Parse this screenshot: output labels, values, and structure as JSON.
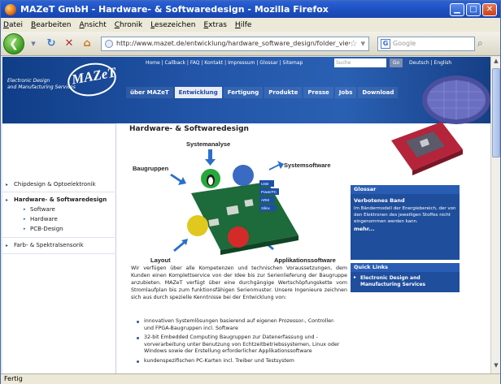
{
  "window": {
    "title": "MAZeT GmbH - Hardware- & Softwaredesign - Mozilla Firefox"
  },
  "menu": [
    "Datei",
    "Bearbeiten",
    "Ansicht",
    "Chronik",
    "Lesezeichen",
    "Extras",
    "Hilfe"
  ],
  "nav": {
    "url": "http://www.mazet.de/entwicklung/hardware_software_design/folder_view",
    "search_placeholder": "Google"
  },
  "site": {
    "logo_word": "MAZeT",
    "logo_tagline_1": "Electronic Design",
    "logo_tagline_2": "and Manufacturing Services",
    "toplinks": "Home | Callback | FAQ | Kontakt | Impressum | Glossar | Sitemap",
    "search_placeholder": "Suche",
    "search_go": "Go",
    "lang": "Deutsch | English",
    "mainnav": [
      "über MAZeT",
      "Entwicklung",
      "Fertigung",
      "Produkte",
      "Presse",
      "Jobs",
      "Download"
    ]
  },
  "leftnav": {
    "items": [
      "Chipdesign & Optoelektronik",
      "Hardware- & Softwaredesign",
      "Farb- & Spektralsensorik"
    ],
    "subitems": [
      "Software",
      "Hardware",
      "PCB-Design"
    ]
  },
  "main": {
    "heading": "Hardware- & Softwaredesign",
    "diagram": {
      "systemanalyse": "Systemanalyse",
      "systemsoftware": "Systemsoftware",
      "baugruppen": "Baugruppen",
      "layout": "Layout",
      "applikationssoftware": "Applikationssoftware",
      "chip_labels": [
        "USB",
        "PowerPC",
        "ARM",
        "Xilinx"
      ]
    },
    "body": "Wir verfügen über alle Kompetenzen und technischen Voraussetzungen, dem Kunden einen Komplettservice von der Idee bis zur Serienlieferung der Baugruppe anzubieten. MAZeT verfügt über eine durchgängige Wertschöpfungskette vom Stromlaufplan bis zum funktionsfähigen Serienmuster. Unsere Ingenieure zeichnen sich aus durch spezielle Kenntnisse bei der Entwicklung von:",
    "bullets": [
      "innovativen Systemlösungen basierend auf eigenen Prozessor-, Controller- und FPGA-Baugruppen incl. Software",
      "32-bit Embedded Computing Baugruppen zur Datenerfassung und -vorverarbeitung unter Benutzung von Echtzeitbetriebssystemen, Linux oder Windows sowie der Erstellung erforderlicher Applikationssoftware",
      "kundenspezifischen PC-Karten incl. Treiber und Testsystem"
    ]
  },
  "glossar": {
    "header": "Glossar",
    "term": "Verbotenes Band",
    "text": "Im Bändermodell der Energiebereich, der von den Elektronen des jeweiligen Stoffes nicht eingenommen werden kann.",
    "more": "mehr..."
  },
  "quicklinks": {
    "header": "Quick Links",
    "link": "Electronic Design and Manufacturing Services"
  },
  "status": "Fertig"
}
